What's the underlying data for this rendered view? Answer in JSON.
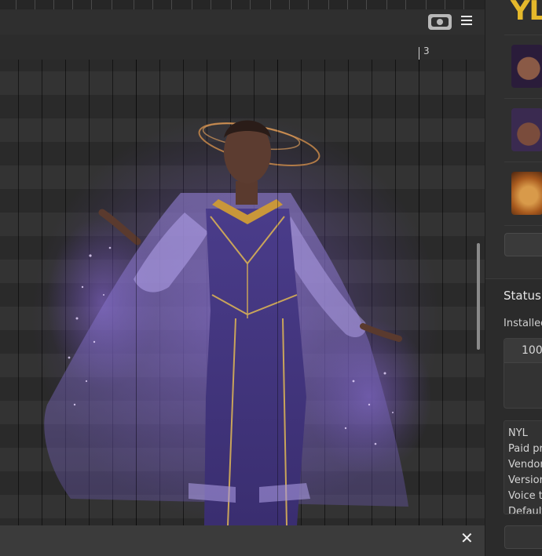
{
  "timeline": {
    "marker_label": "3",
    "camera_icon": "camera-icon",
    "menu_icon": "hamburger-menu-icon",
    "close_label": "✕"
  },
  "artwork": {
    "subject": "character-illustration"
  },
  "voicebanks": {
    "logo_text": "YL",
    "items": [
      {
        "name": "voicebank-avatar-1"
      },
      {
        "name": "voicebank-avatar-2"
      },
      {
        "name": "voicebank-avatar-3"
      }
    ]
  },
  "status": {
    "heading": "Status",
    "installed_label": "Installed",
    "installed_value": "100",
    "info_lines": [
      "NYL",
      "Paid pr",
      "Vendor",
      "Version",
      "Voice t",
      "Default"
    ]
  },
  "colors": {
    "accent_gold": "#e5b92b",
    "panel_bg": "#2b2b2b",
    "grid_bg": "#2a2a2a"
  }
}
